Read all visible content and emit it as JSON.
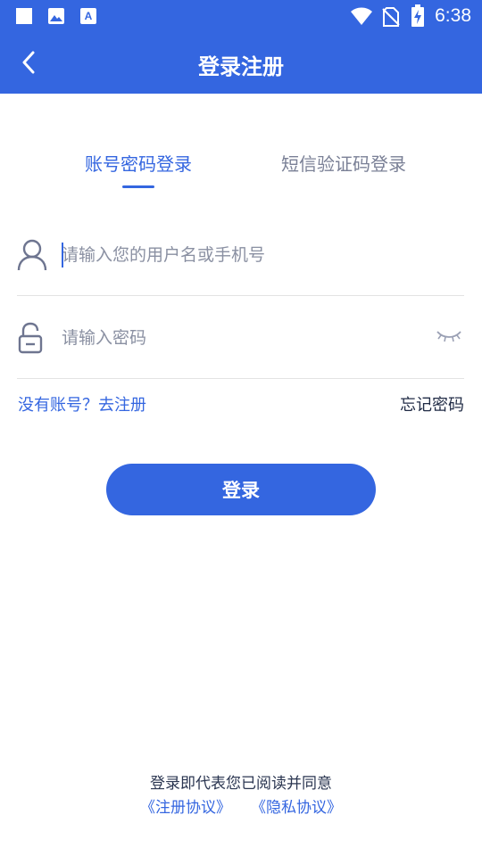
{
  "status_bar": {
    "time": "6:38",
    "left_icons": [
      "square-icon",
      "image-icon",
      "a-icon"
    ],
    "right_icons": [
      "wifi-icon",
      "no-sim-icon",
      "battery-charging-icon"
    ]
  },
  "header": {
    "title": "登录注册",
    "background": "#3466E0"
  },
  "tabs": [
    {
      "label": "账号密码登录",
      "active": true
    },
    {
      "label": "短信验证码登录",
      "active": false
    }
  ],
  "form": {
    "username": {
      "placeholder": "请输入您的用户名或手机号",
      "value": "",
      "icon": "user-icon"
    },
    "password": {
      "placeholder": "请输入密码",
      "value": "",
      "icon": "lock-icon",
      "toggle_icon": "eye-closed-icon"
    }
  },
  "links": {
    "register": "没有账号？去注册",
    "forgot": "忘记密码"
  },
  "login_button": "登录",
  "agreement": {
    "text": "登录即代表您已阅读并同意",
    "terms": "《注册协议》",
    "privacy": "《隐私协议》"
  },
  "colors": {
    "primary": "#3466E0",
    "muted": "#7A8096"
  }
}
